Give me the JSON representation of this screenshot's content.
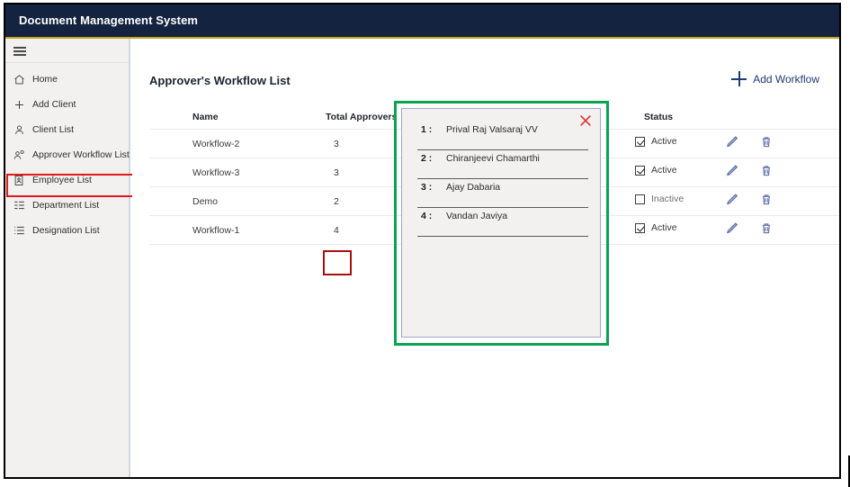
{
  "window": {
    "title": "Document Management System"
  },
  "sidebar": {
    "toggle_icon": "hamburger-menu-icon",
    "items": [
      {
        "label": "Home",
        "icon": "home-icon"
      },
      {
        "label": "Add Client",
        "icon": "plus-icon"
      },
      {
        "label": "Client List",
        "icon": "person-icon"
      },
      {
        "label": "Approver Workflow List",
        "icon": "person-settings-icon",
        "selected": true
      },
      {
        "label": "Employee List",
        "icon": "employee-badge-icon"
      },
      {
        "label": "Department List",
        "icon": "list-detail-icon"
      },
      {
        "label": "Designation List",
        "icon": "list-icon"
      }
    ]
  },
  "main": {
    "page_title": "Approver's Workflow List",
    "add_button": {
      "label": "Add Workflow",
      "icon": "plus-icon"
    },
    "table": {
      "columns": [
        "Name",
        "Total Approvers",
        "Status"
      ],
      "rows": [
        {
          "name": "Workflow-2",
          "total_approvers": "3",
          "status": "Active",
          "checked": true,
          "edit_icon": "pencil-icon",
          "delete_icon": "trash-icon"
        },
        {
          "name": "Workflow-3",
          "total_approvers": "3",
          "status": "Active",
          "checked": true,
          "edit_icon": "pencil-icon",
          "delete_icon": "trash-icon"
        },
        {
          "name": "Demo",
          "total_approvers": "2",
          "status": "Inactive",
          "checked": false,
          "edit_icon": "pencil-icon",
          "delete_icon": "trash-icon"
        },
        {
          "name": "Workflow-1",
          "total_approvers": "4",
          "status": "Active",
          "checked": true,
          "edit_icon": "pencil-icon",
          "delete_icon": "trash-icon"
        }
      ]
    }
  },
  "approvers_modal": {
    "close_icon": "close-x-icon",
    "approvers": [
      {
        "index": "1 :",
        "name": "Prival Raj Valsaraj VV"
      },
      {
        "index": "2 :",
        "name": "Chiranjeevi Chamarthi"
      },
      {
        "index": "3 :",
        "name": "Ajay Dabaria"
      },
      {
        "index": "4 :",
        "name": "Vandan Javiya"
      }
    ]
  },
  "annotations": {
    "sidebar_highlight_color": "#e01b1b",
    "total_cell_highlight_color": "#a81010",
    "modal_highlight_color": "#0aa450"
  },
  "colors": {
    "app_bar": "#14233f",
    "app_bar_accent": "#c9a227",
    "sidebar_bg": "#f2f1ef",
    "accent_blue": "#1f3b73",
    "action_icon": "#5f6fa8",
    "close_red": "#e03131"
  }
}
